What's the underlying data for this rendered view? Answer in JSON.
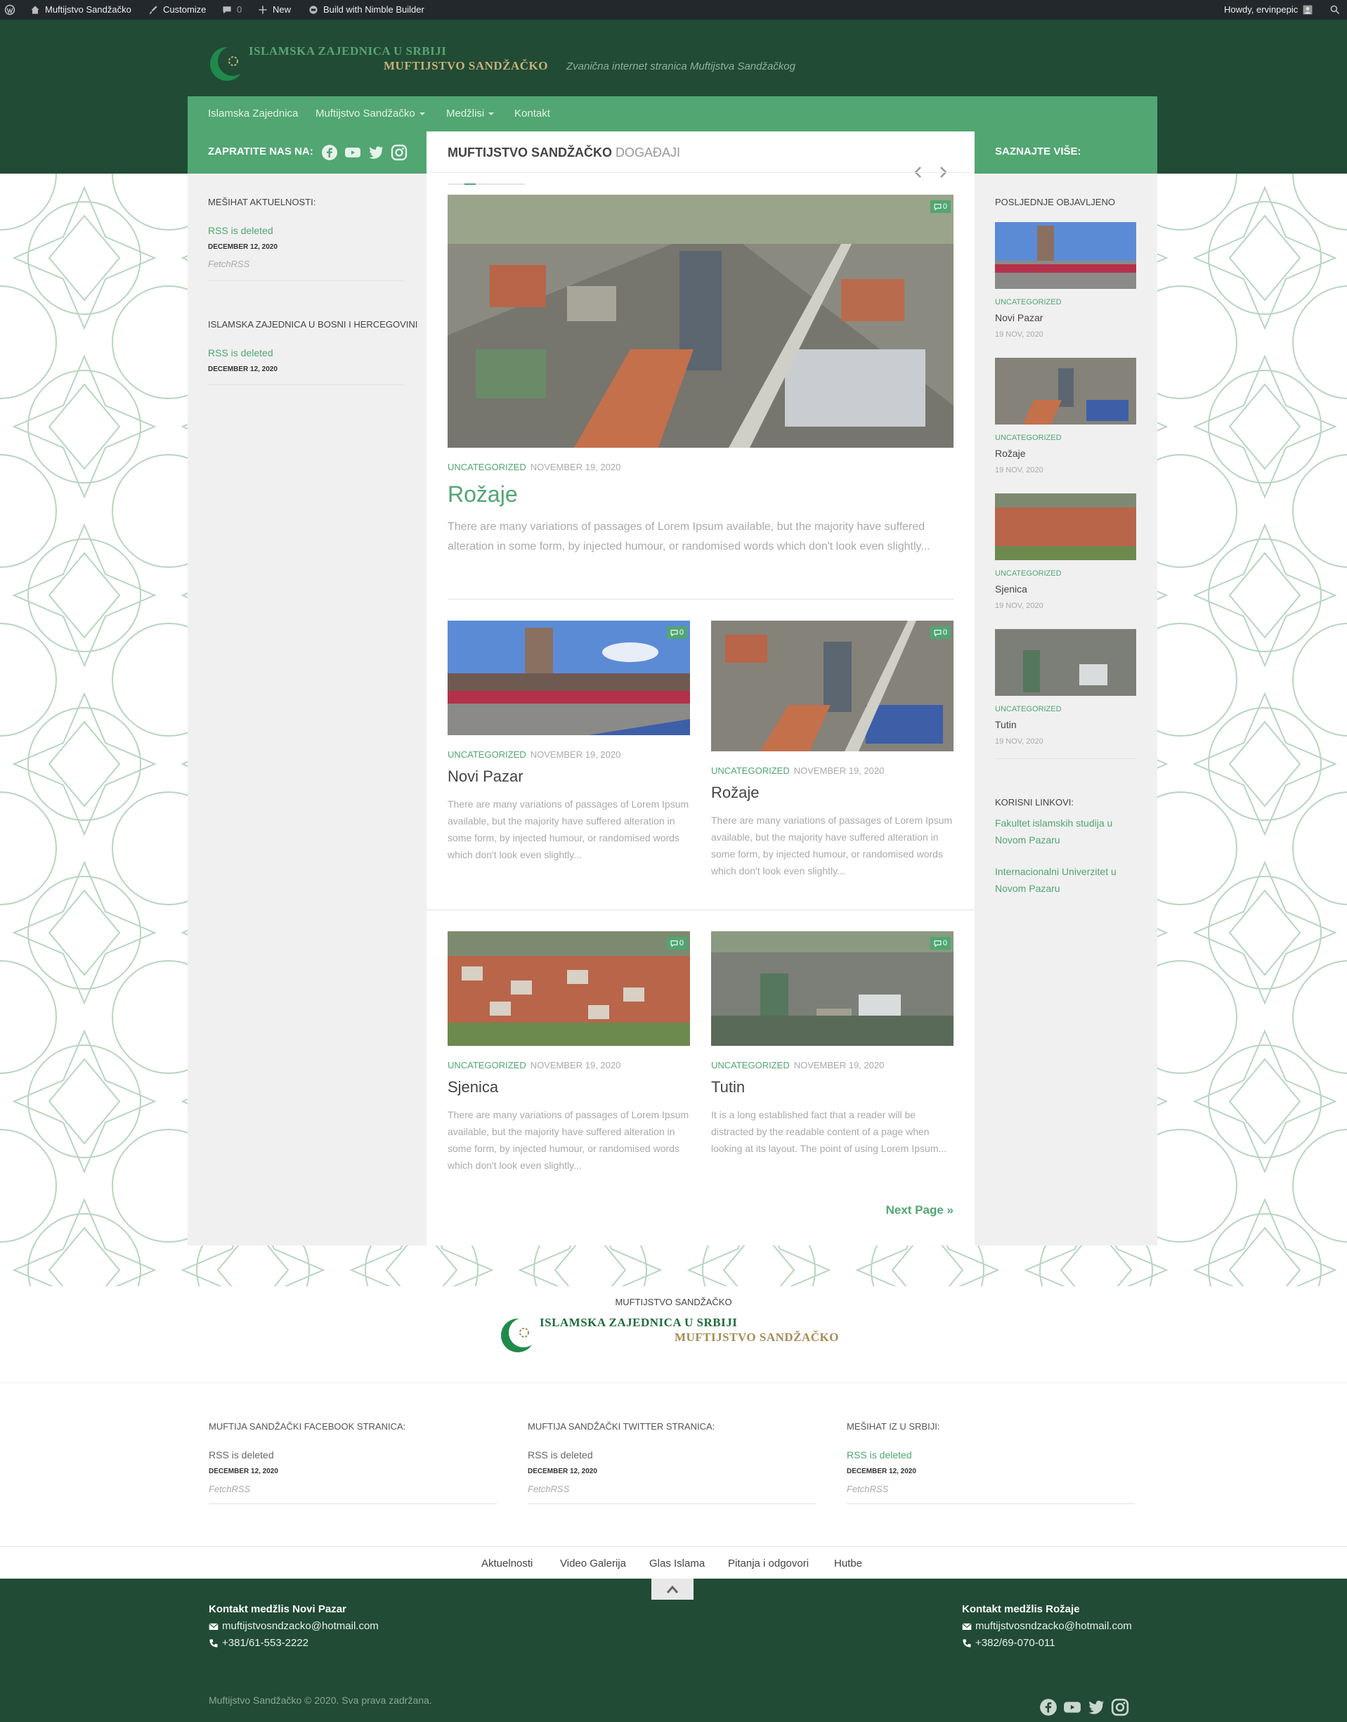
{
  "adminbar": {
    "site_name": "Muftijstvo Sandžačko",
    "customize": "Customize",
    "comments_count": "0",
    "new": "New",
    "builder": "Build with Nimble Builder",
    "howdy": "Howdy, ervinpepic"
  },
  "header": {
    "logo_line1": "ISLAMSKA ZAJEDNICA U SRBIJI",
    "logo_line2": "MUFTIJSTVO SANDŽAČKO",
    "tagline": "Zvanična internet stranica Muftijstva Sandžačkog"
  },
  "nav": {
    "items": [
      {
        "label": "Islamska Zajednica"
      },
      {
        "label": "Muftijstvo Sandžačko"
      },
      {
        "label": "Medžlisi"
      },
      {
        "label": "Kontakt"
      }
    ]
  },
  "left_sidebar": {
    "follow_label": "ZAPRATITE NAS NA:",
    "social_icons": [
      "facebook-icon",
      "youtube-icon",
      "twitter-icon",
      "instagram-icon"
    ],
    "widgets": [
      {
        "title": "MEŠIHAT AKTUELNOSTI:",
        "link": "RSS is deleted",
        "date": "DECEMBER 12, 2020",
        "source": "FetchRSS"
      },
      {
        "title": "ISLAMSKA ZAJEDNICA U BOSNI I HERCEGOVINI",
        "link": "RSS is deleted",
        "date": "DECEMBER 12, 2020"
      }
    ]
  },
  "content": {
    "title_main": "MUFTIJSTVO SANDŽAČKO",
    "title_sub": "DOGAĐAJI",
    "featured": {
      "category": "UNCATEGORIZED",
      "date": "NOVEMBER 19, 2020",
      "title": "Rožaje",
      "comments": "0",
      "excerpt": "There are many variations of passages of Lorem Ipsum available, but the majority have suffered alteration in some form, by injected humour, or randomised words which don't look even slightly..."
    },
    "posts": [
      {
        "category": "UNCATEGORIZED",
        "date": "NOVEMBER 19, 2020",
        "title": "Novi Pazar",
        "comments": "0",
        "excerpt": "There are many variations of passages of Lorem Ipsum available, but the majority have suffered alteration in some form, by injected humour, or randomised words which don't look even slightly..."
      },
      {
        "category": "UNCATEGORIZED",
        "date": "NOVEMBER 19, 2020",
        "title": "Rožaje",
        "comments": "0",
        "excerpt": "There are many variations of passages of Lorem Ipsum available, but the majority have suffered alteration in some form, by injected humour, or randomised words which don't look even slightly..."
      },
      {
        "category": "UNCATEGORIZED",
        "date": "NOVEMBER 19, 2020",
        "title": "Sjenica",
        "comments": "0",
        "excerpt": "There are many variations of passages of Lorem Ipsum available, but the majority have suffered alteration in some form, by injected humour, or randomised words which don't look even slightly..."
      },
      {
        "category": "UNCATEGORIZED",
        "date": "NOVEMBER 19, 2020",
        "title": "Tutin",
        "comments": "0",
        "excerpt": "It is a long established fact that a reader will be distracted by the readable content of a page when looking at its layout. The point of using Lorem Ipsum..."
      }
    ],
    "next_page": "Next Page »"
  },
  "right_sidebar": {
    "head_label": "SAZNAJTE VIŠE:",
    "recent_title": "POSLJEDNJE OBJAVLJENO",
    "recent": [
      {
        "category": "UNCATEGORIZED",
        "title": "Novi Pazar",
        "date": "19 NOV, 2020"
      },
      {
        "category": "UNCATEGORIZED",
        "title": "Rožaje",
        "date": "19 NOV, 2020"
      },
      {
        "category": "UNCATEGORIZED",
        "title": "Sjenica",
        "date": "19 NOV, 2020"
      },
      {
        "category": "UNCATEGORIZED",
        "title": "Tutin",
        "date": "19 NOV, 2020"
      }
    ],
    "links_title": "KORISNI LINKOVI:",
    "links": [
      {
        "label": "Fakultet islamskih studija u Novom Pazaru"
      },
      {
        "label": "Internacionalni Univerzitet u Novom Pazaru"
      }
    ]
  },
  "footer": {
    "logo_label": "MUFTIJSTVO SANDŽAČKO",
    "logo_line1": "ISLAMSKA ZAJEDNICA U SRBIJI",
    "logo_line2": "MUFTIJSTVO SANDŽAČKO",
    "columns": [
      {
        "title": "MUFTIJA SANDŽAČKI FACEBOOK STRANICA:",
        "link": "RSS is deleted",
        "date": "DECEMBER 12, 2020",
        "source": "FetchRSS"
      },
      {
        "title": "MUFTIJA SANDŽAČKI TWITTER STRANICA:",
        "link": "RSS is deleted",
        "date": "DECEMBER 12, 2020",
        "source": "FetchRSS"
      },
      {
        "title": "MEŠIHAT IZ U SRBIJI:",
        "link": "RSS is deleted",
        "date": "DECEMBER 12, 2020",
        "source": "FetchRSS"
      }
    ],
    "menu": [
      "Aktuelnosti",
      "Video Galerija",
      "Glas Islama",
      "Pitanja i odgovori",
      "Hutbe"
    ],
    "contact_left": {
      "title": "Kontakt medžlis Novi Pazar",
      "email": "muftijstvosndzacko@hotmail.com",
      "phone": "+381/61-553-2222"
    },
    "contact_right": {
      "title": "Kontakt medžlis Rožaje",
      "email": "muftijstvosndzacko@hotmail.com",
      "phone": "+382/69-070-011"
    },
    "copyright": "Muftijstvo Sandžačko © 2020. Sva prava zadržana."
  },
  "colors": {
    "brand_dark": "#214b34",
    "brand_green": "#51a672",
    "accent_gold": "#c9b07a"
  }
}
